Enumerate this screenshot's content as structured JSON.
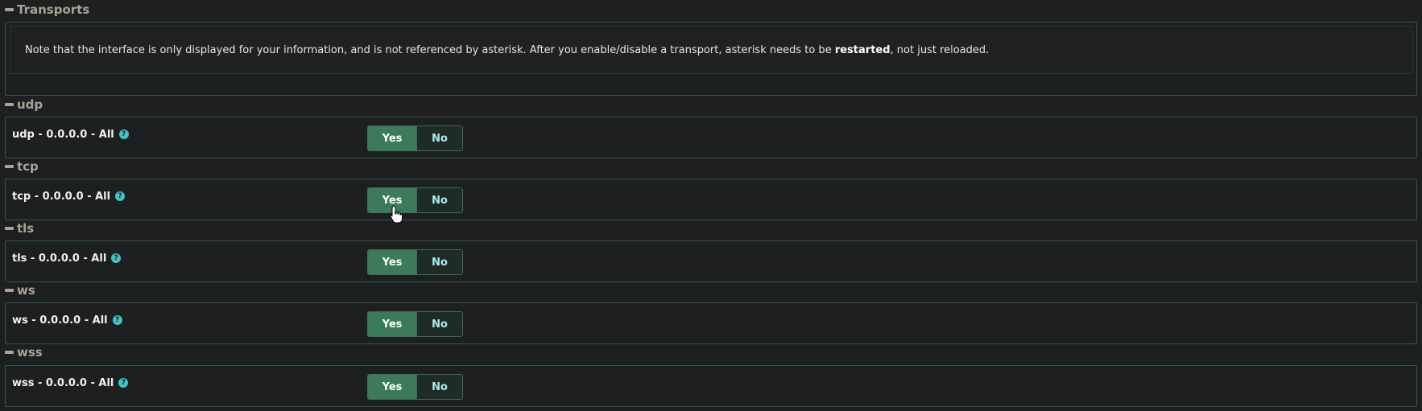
{
  "transports_section": {
    "title": "Transports",
    "note_before": "Note that the interface is only displayed for your information, and is not referenced by asterisk. After you enable/disable a transport, asterisk needs to be ",
    "note_bold": "restarted",
    "note_after": ", not just reloaded."
  },
  "transports": [
    {
      "header": "udp",
      "label": "udp - 0.0.0.0 - All",
      "yes": "Yes",
      "no": "No",
      "selected": "Yes"
    },
    {
      "header": "tcp",
      "label": "tcp - 0.0.0.0 - All",
      "yes": "Yes",
      "no": "No",
      "selected": "Yes"
    },
    {
      "header": "tls",
      "label": "tls - 0.0.0.0 - All",
      "yes": "Yes",
      "no": "No",
      "selected": "Yes"
    },
    {
      "header": "ws",
      "label": "ws - 0.0.0.0 - All",
      "yes": "Yes",
      "no": "No",
      "selected": "Yes"
    },
    {
      "header": "wss",
      "label": "wss - 0.0.0.0 - All",
      "yes": "Yes",
      "no": "No",
      "selected": "Yes"
    }
  ],
  "help_glyph": "?",
  "colors": {
    "accent_green": "#3b7a5a",
    "border_green": "#2f5a48",
    "help_teal": "#3fc5c5",
    "no_text": "#a8ecef"
  },
  "icons": {
    "collapse": "minus-icon",
    "help": "question-circle-icon",
    "cursor": "hand-pointer-icon"
  }
}
